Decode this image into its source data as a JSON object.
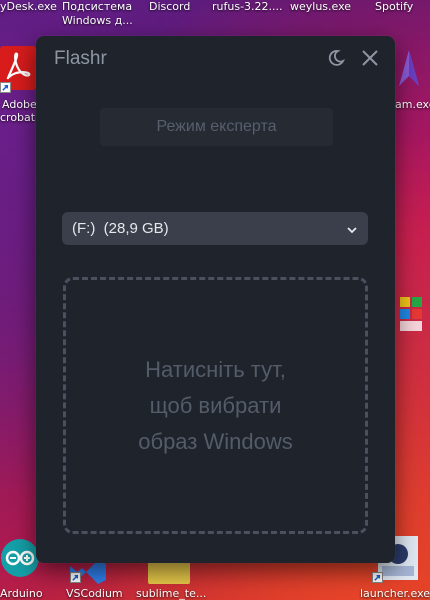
{
  "desktop": {
    "top_labels": [
      "yDesk.exe",
      "Подсистема",
      "Windows д...",
      "Discord",
      "rufus-3.22....",
      "weylus.exe",
      "Spotify"
    ],
    "left_icons": [
      {
        "label1": "Adobe",
        "label2": "crobat I"
      },
      {
        "label1": "Arduino"
      },
      {
        "label1": "VSCodium"
      },
      {
        "label1": "sublime_te..."
      }
    ],
    "right_icons": [
      {
        "label": "am.exe"
      },
      {
        "label": "launcher.exe"
      }
    ]
  },
  "app": {
    "title": "Flashr",
    "expert_mode_label": "Режим експерта",
    "drive": {
      "selected": "(F:)  (28,9 GB)"
    },
    "dropzone_text": "Натисніть тут,\nщоб вибрати\nобраз Windows"
  },
  "colors": {
    "window_bg": "#1f232b",
    "select_bg": "#3a3f4b",
    "muted_text": "#545b69"
  }
}
